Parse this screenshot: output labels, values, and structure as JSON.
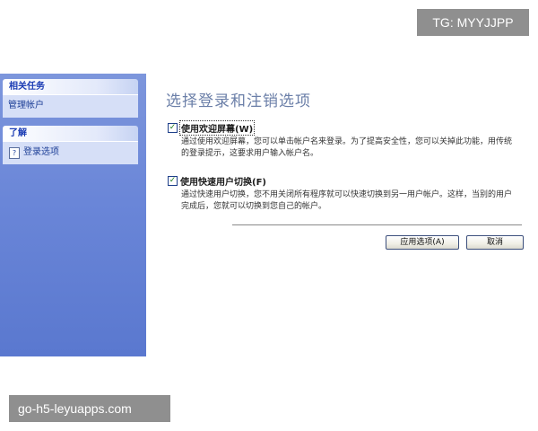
{
  "watermarks": {
    "top": "TG: MYYJJPP",
    "bottom": "go-h5-leyuapps.com"
  },
  "sidebar": {
    "tasks_panel": {
      "title": "相关任务",
      "items": [
        {
          "label": "管理帐户"
        }
      ]
    },
    "learn_panel": {
      "title": "了解",
      "items": [
        {
          "label": "登录选项",
          "icon": "help-icon"
        }
      ]
    }
  },
  "main": {
    "title": "选择登录和注销选项",
    "options": [
      {
        "label": "使用欢迎屏幕(W)",
        "checked": true,
        "description": "通过使用欢迎屏幕，您可以单击帐户名来登录。为了提高安全性，您可以关掉此功能，用传统的登录提示，这要求用户输入帐户名。"
      },
      {
        "label": "使用快速用户切换(F)",
        "checked": true,
        "description": "通过快速用户切换，您不用关闭所有程序就可以快速切换到另一用户帐户。这样，当别的用户完成后，您就可以切换到您自己的帐户。"
      }
    ],
    "buttons": {
      "apply": "应用选项(A)",
      "cancel": "取消"
    }
  },
  "colors": {
    "sidebar_bg": "#6a86d8",
    "panel_header_text": "#1b3cb4",
    "title_text": "#6b7fa8"
  }
}
